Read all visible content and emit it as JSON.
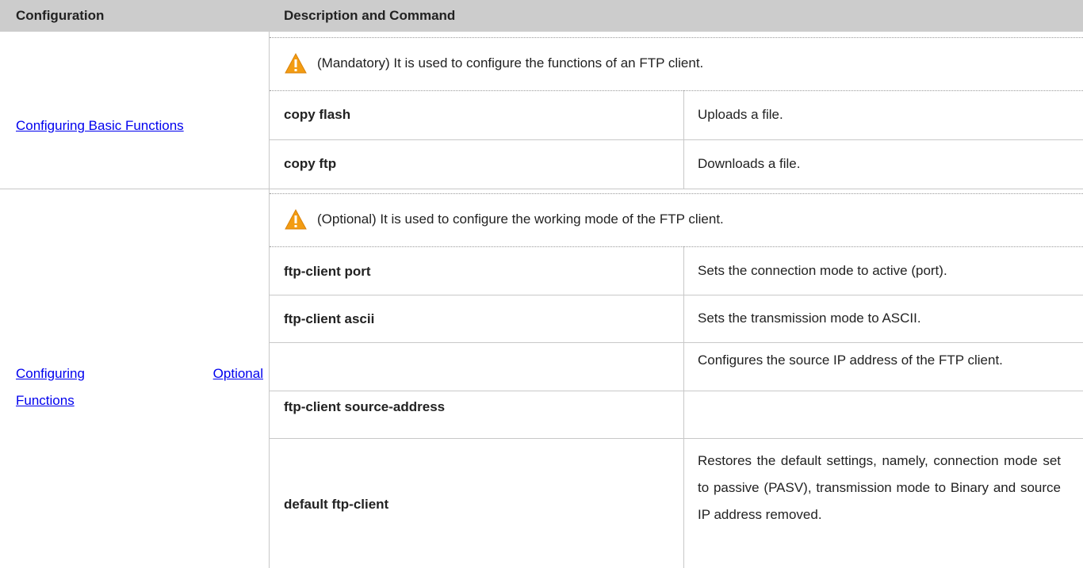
{
  "table": {
    "headers": {
      "configuration": "Configuration",
      "description": "Description and Command"
    },
    "groups": [
      {
        "link_label": "Configuring Basic Functions",
        "note": "(Mandatory) It is used to configure the functions of an FTP client.",
        "note_icon": "warning-icon",
        "commands": [
          {
            "command": "copy flash",
            "description": "Uploads a file."
          },
          {
            "command": "copy ftp",
            "description": "Downloads a file."
          }
        ]
      },
      {
        "link_label_line1_a": "Configuring",
        "link_label_line1_b": "Optional",
        "link_label_line2": "Functions",
        "note": "(Optional) It is used to configure the working mode of the FTP client.",
        "note_icon": "warning-icon",
        "commands": [
          {
            "command": "ftp-client port",
            "description": "Sets the connection mode to active (port)."
          },
          {
            "command": "ftp-client ascii",
            "description": "Sets the transmission mode to ASCII."
          },
          {
            "command": "ftp-client source-address",
            "description": "Configures the source IP address of the FTP client."
          },
          {
            "command": "default ftp-client",
            "description": "Restores the default settings, namely, connection mode set to passive (PASV), transmission mode to Binary and source IP address removed."
          }
        ]
      }
    ]
  },
  "colors": {
    "header_bg": "#cccccc",
    "link": "#0000ee",
    "warning_orange": "#f39c12",
    "grid": "#c8c8c8"
  }
}
